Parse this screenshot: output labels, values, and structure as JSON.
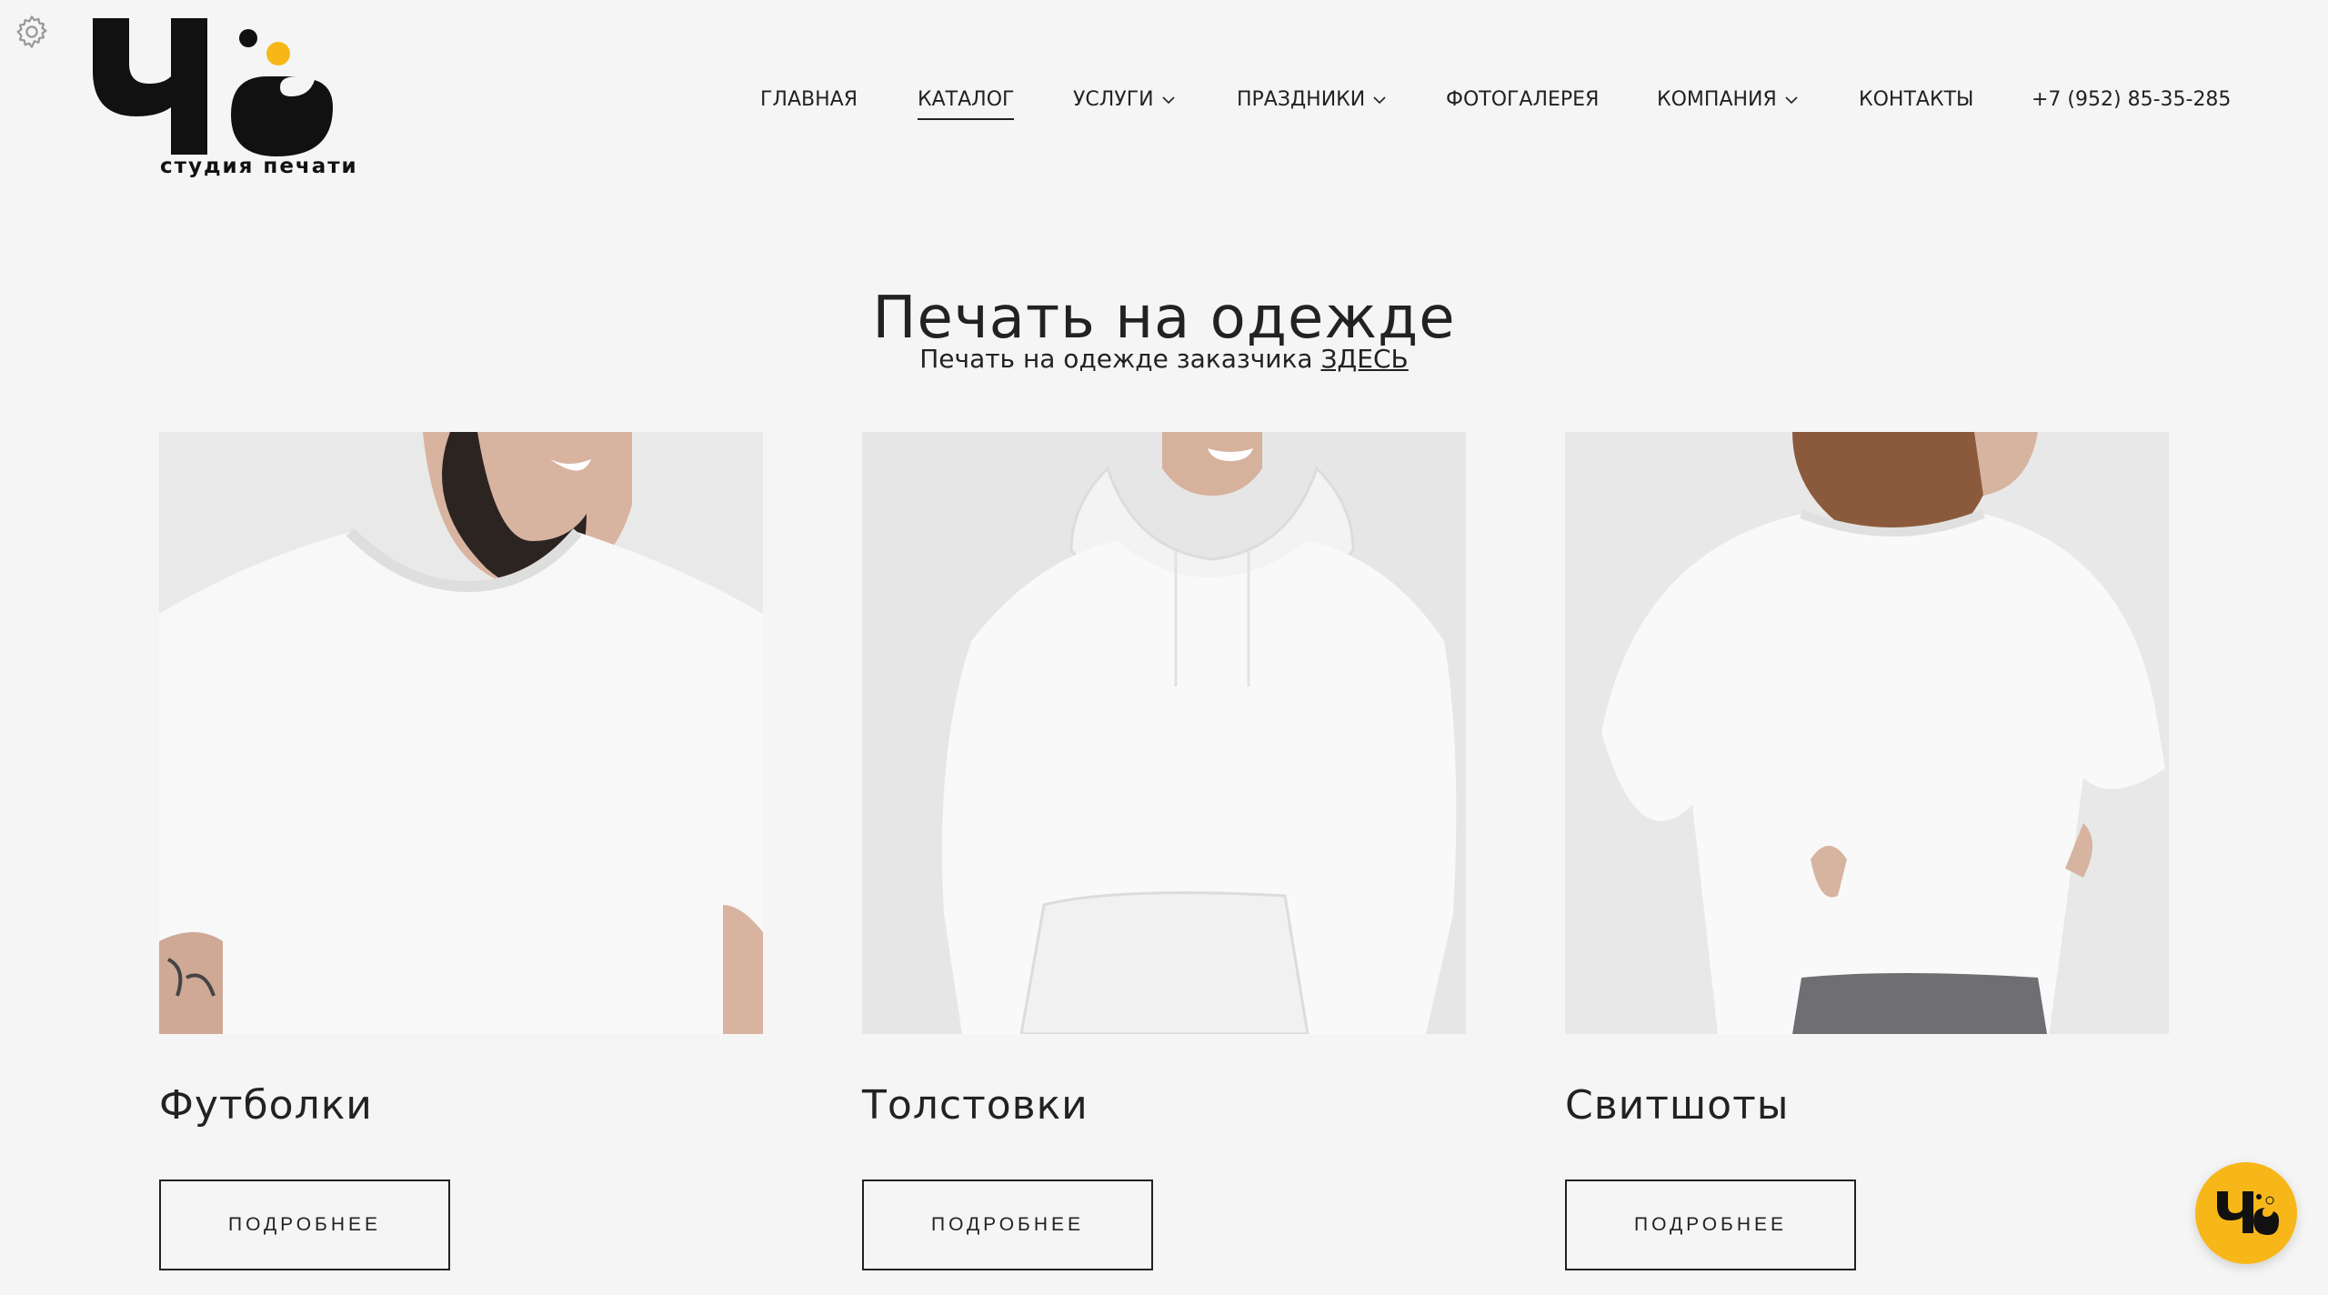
{
  "brand": {
    "logo_text": "Чё",
    "tagline": "студия печати",
    "accent": "#f7b718"
  },
  "nav": {
    "items": [
      {
        "label": "ГЛАВНАЯ",
        "dropdown": false,
        "active": false
      },
      {
        "label": "КАТАЛОГ",
        "dropdown": false,
        "active": true
      },
      {
        "label": "УСЛУГИ",
        "dropdown": true,
        "active": false
      },
      {
        "label": "ПРАЗДНИКИ",
        "dropdown": true,
        "active": false
      },
      {
        "label": "ФОТОГАЛЕРЕЯ",
        "dropdown": false,
        "active": false
      },
      {
        "label": "КОМПАНИЯ",
        "dropdown": true,
        "active": false
      },
      {
        "label": "КОНТАКТЫ",
        "dropdown": false,
        "active": false
      }
    ],
    "phone": "+7 (952) 85-35-285"
  },
  "page": {
    "title": "Печать на одежде",
    "subtitle_text": "Печать на одежде заказчика",
    "subtitle_link": "ЗДЕСЬ"
  },
  "products": [
    {
      "name": "Футболки",
      "button": "ПОДРОБНЕЕ"
    },
    {
      "name": "Толстовки",
      "button": "ПОДРОБНЕЕ"
    },
    {
      "name": "Свитшоты",
      "button": "ПОДРОБНЕЕ"
    }
  ],
  "icons": {
    "settings": "gear-icon",
    "chevron": "chevron-down-icon",
    "chat": "chat-logo-icon"
  }
}
